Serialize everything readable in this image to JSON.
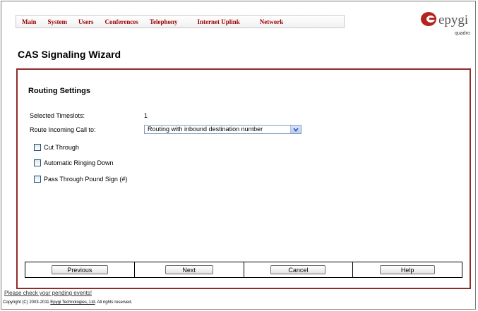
{
  "nav": {
    "items": [
      "Main",
      "System",
      "Users",
      "Conferences",
      "Telephony",
      "Internet Uplink",
      "Network"
    ]
  },
  "logo": {
    "name": "epygi",
    "sub": "quadro",
    "accent": "#b3241f"
  },
  "page_title": "CAS Signaling Wizard",
  "section_title": "Routing Settings",
  "fields": {
    "timeslots_label": "Selected Timeslots:",
    "timeslots_value": "1",
    "route_label": "Route Incoming Call to:",
    "route_value": "Routing with inbound destination number"
  },
  "checkboxes": [
    {
      "label": "Cut Through",
      "checked": false
    },
    {
      "label": "Automatic Ringing Down",
      "checked": false
    },
    {
      "label": "Pass Through Pound Sign (#)",
      "checked": false
    }
  ],
  "buttons": {
    "previous": "Previous",
    "next": "Next",
    "cancel": "Cancel",
    "help": "Help"
  },
  "footer": {
    "pending": "Please check your pending events!",
    "copyright_prefix": "Copyright (C) 2003-2011 ",
    "company": "Epygi Technologies, Ltd",
    "copyright_suffix": ". All rights reserved."
  },
  "colors": {
    "nav_text": "#9a0000",
    "panel_border": "#8e2b2b"
  }
}
